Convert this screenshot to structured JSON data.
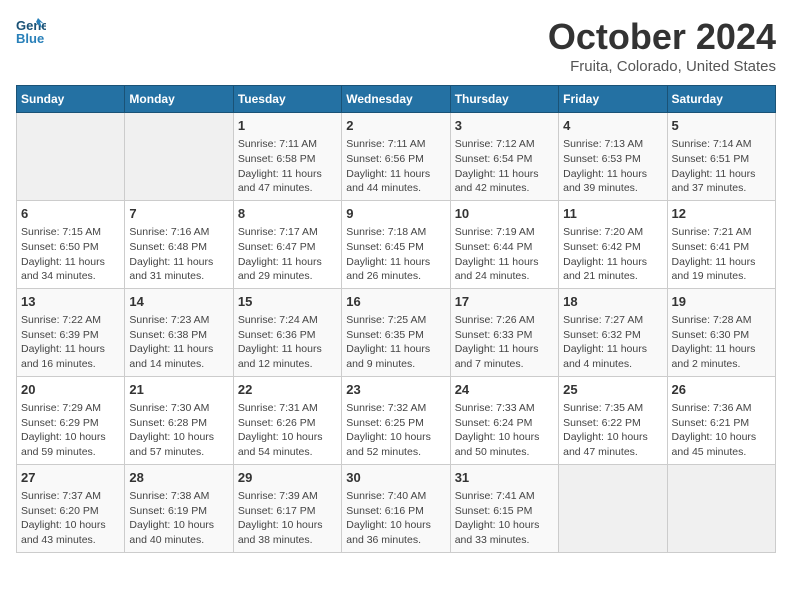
{
  "header": {
    "logo_line1": "General",
    "logo_line2": "Blue",
    "title": "October 2024",
    "subtitle": "Fruita, Colorado, United States"
  },
  "days_of_week": [
    "Sunday",
    "Monday",
    "Tuesday",
    "Wednesday",
    "Thursday",
    "Friday",
    "Saturday"
  ],
  "weeks": [
    [
      {
        "day": "",
        "info": ""
      },
      {
        "day": "",
        "info": ""
      },
      {
        "day": "1",
        "info": "Sunrise: 7:11 AM\nSunset: 6:58 PM\nDaylight: 11 hours and 47 minutes."
      },
      {
        "day": "2",
        "info": "Sunrise: 7:11 AM\nSunset: 6:56 PM\nDaylight: 11 hours and 44 minutes."
      },
      {
        "day": "3",
        "info": "Sunrise: 7:12 AM\nSunset: 6:54 PM\nDaylight: 11 hours and 42 minutes."
      },
      {
        "day": "4",
        "info": "Sunrise: 7:13 AM\nSunset: 6:53 PM\nDaylight: 11 hours and 39 minutes."
      },
      {
        "day": "5",
        "info": "Sunrise: 7:14 AM\nSunset: 6:51 PM\nDaylight: 11 hours and 37 minutes."
      }
    ],
    [
      {
        "day": "6",
        "info": "Sunrise: 7:15 AM\nSunset: 6:50 PM\nDaylight: 11 hours and 34 minutes."
      },
      {
        "day": "7",
        "info": "Sunrise: 7:16 AM\nSunset: 6:48 PM\nDaylight: 11 hours and 31 minutes."
      },
      {
        "day": "8",
        "info": "Sunrise: 7:17 AM\nSunset: 6:47 PM\nDaylight: 11 hours and 29 minutes."
      },
      {
        "day": "9",
        "info": "Sunrise: 7:18 AM\nSunset: 6:45 PM\nDaylight: 11 hours and 26 minutes."
      },
      {
        "day": "10",
        "info": "Sunrise: 7:19 AM\nSunset: 6:44 PM\nDaylight: 11 hours and 24 minutes."
      },
      {
        "day": "11",
        "info": "Sunrise: 7:20 AM\nSunset: 6:42 PM\nDaylight: 11 hours and 21 minutes."
      },
      {
        "day": "12",
        "info": "Sunrise: 7:21 AM\nSunset: 6:41 PM\nDaylight: 11 hours and 19 minutes."
      }
    ],
    [
      {
        "day": "13",
        "info": "Sunrise: 7:22 AM\nSunset: 6:39 PM\nDaylight: 11 hours and 16 minutes."
      },
      {
        "day": "14",
        "info": "Sunrise: 7:23 AM\nSunset: 6:38 PM\nDaylight: 11 hours and 14 minutes."
      },
      {
        "day": "15",
        "info": "Sunrise: 7:24 AM\nSunset: 6:36 PM\nDaylight: 11 hours and 12 minutes."
      },
      {
        "day": "16",
        "info": "Sunrise: 7:25 AM\nSunset: 6:35 PM\nDaylight: 11 hours and 9 minutes."
      },
      {
        "day": "17",
        "info": "Sunrise: 7:26 AM\nSunset: 6:33 PM\nDaylight: 11 hours and 7 minutes."
      },
      {
        "day": "18",
        "info": "Sunrise: 7:27 AM\nSunset: 6:32 PM\nDaylight: 11 hours and 4 minutes."
      },
      {
        "day": "19",
        "info": "Sunrise: 7:28 AM\nSunset: 6:30 PM\nDaylight: 11 hours and 2 minutes."
      }
    ],
    [
      {
        "day": "20",
        "info": "Sunrise: 7:29 AM\nSunset: 6:29 PM\nDaylight: 10 hours and 59 minutes."
      },
      {
        "day": "21",
        "info": "Sunrise: 7:30 AM\nSunset: 6:28 PM\nDaylight: 10 hours and 57 minutes."
      },
      {
        "day": "22",
        "info": "Sunrise: 7:31 AM\nSunset: 6:26 PM\nDaylight: 10 hours and 54 minutes."
      },
      {
        "day": "23",
        "info": "Sunrise: 7:32 AM\nSunset: 6:25 PM\nDaylight: 10 hours and 52 minutes."
      },
      {
        "day": "24",
        "info": "Sunrise: 7:33 AM\nSunset: 6:24 PM\nDaylight: 10 hours and 50 minutes."
      },
      {
        "day": "25",
        "info": "Sunrise: 7:35 AM\nSunset: 6:22 PM\nDaylight: 10 hours and 47 minutes."
      },
      {
        "day": "26",
        "info": "Sunrise: 7:36 AM\nSunset: 6:21 PM\nDaylight: 10 hours and 45 minutes."
      }
    ],
    [
      {
        "day": "27",
        "info": "Sunrise: 7:37 AM\nSunset: 6:20 PM\nDaylight: 10 hours and 43 minutes."
      },
      {
        "day": "28",
        "info": "Sunrise: 7:38 AM\nSunset: 6:19 PM\nDaylight: 10 hours and 40 minutes."
      },
      {
        "day": "29",
        "info": "Sunrise: 7:39 AM\nSunset: 6:17 PM\nDaylight: 10 hours and 38 minutes."
      },
      {
        "day": "30",
        "info": "Sunrise: 7:40 AM\nSunset: 6:16 PM\nDaylight: 10 hours and 36 minutes."
      },
      {
        "day": "31",
        "info": "Sunrise: 7:41 AM\nSunset: 6:15 PM\nDaylight: 10 hours and 33 minutes."
      },
      {
        "day": "",
        "info": ""
      },
      {
        "day": "",
        "info": ""
      }
    ]
  ]
}
